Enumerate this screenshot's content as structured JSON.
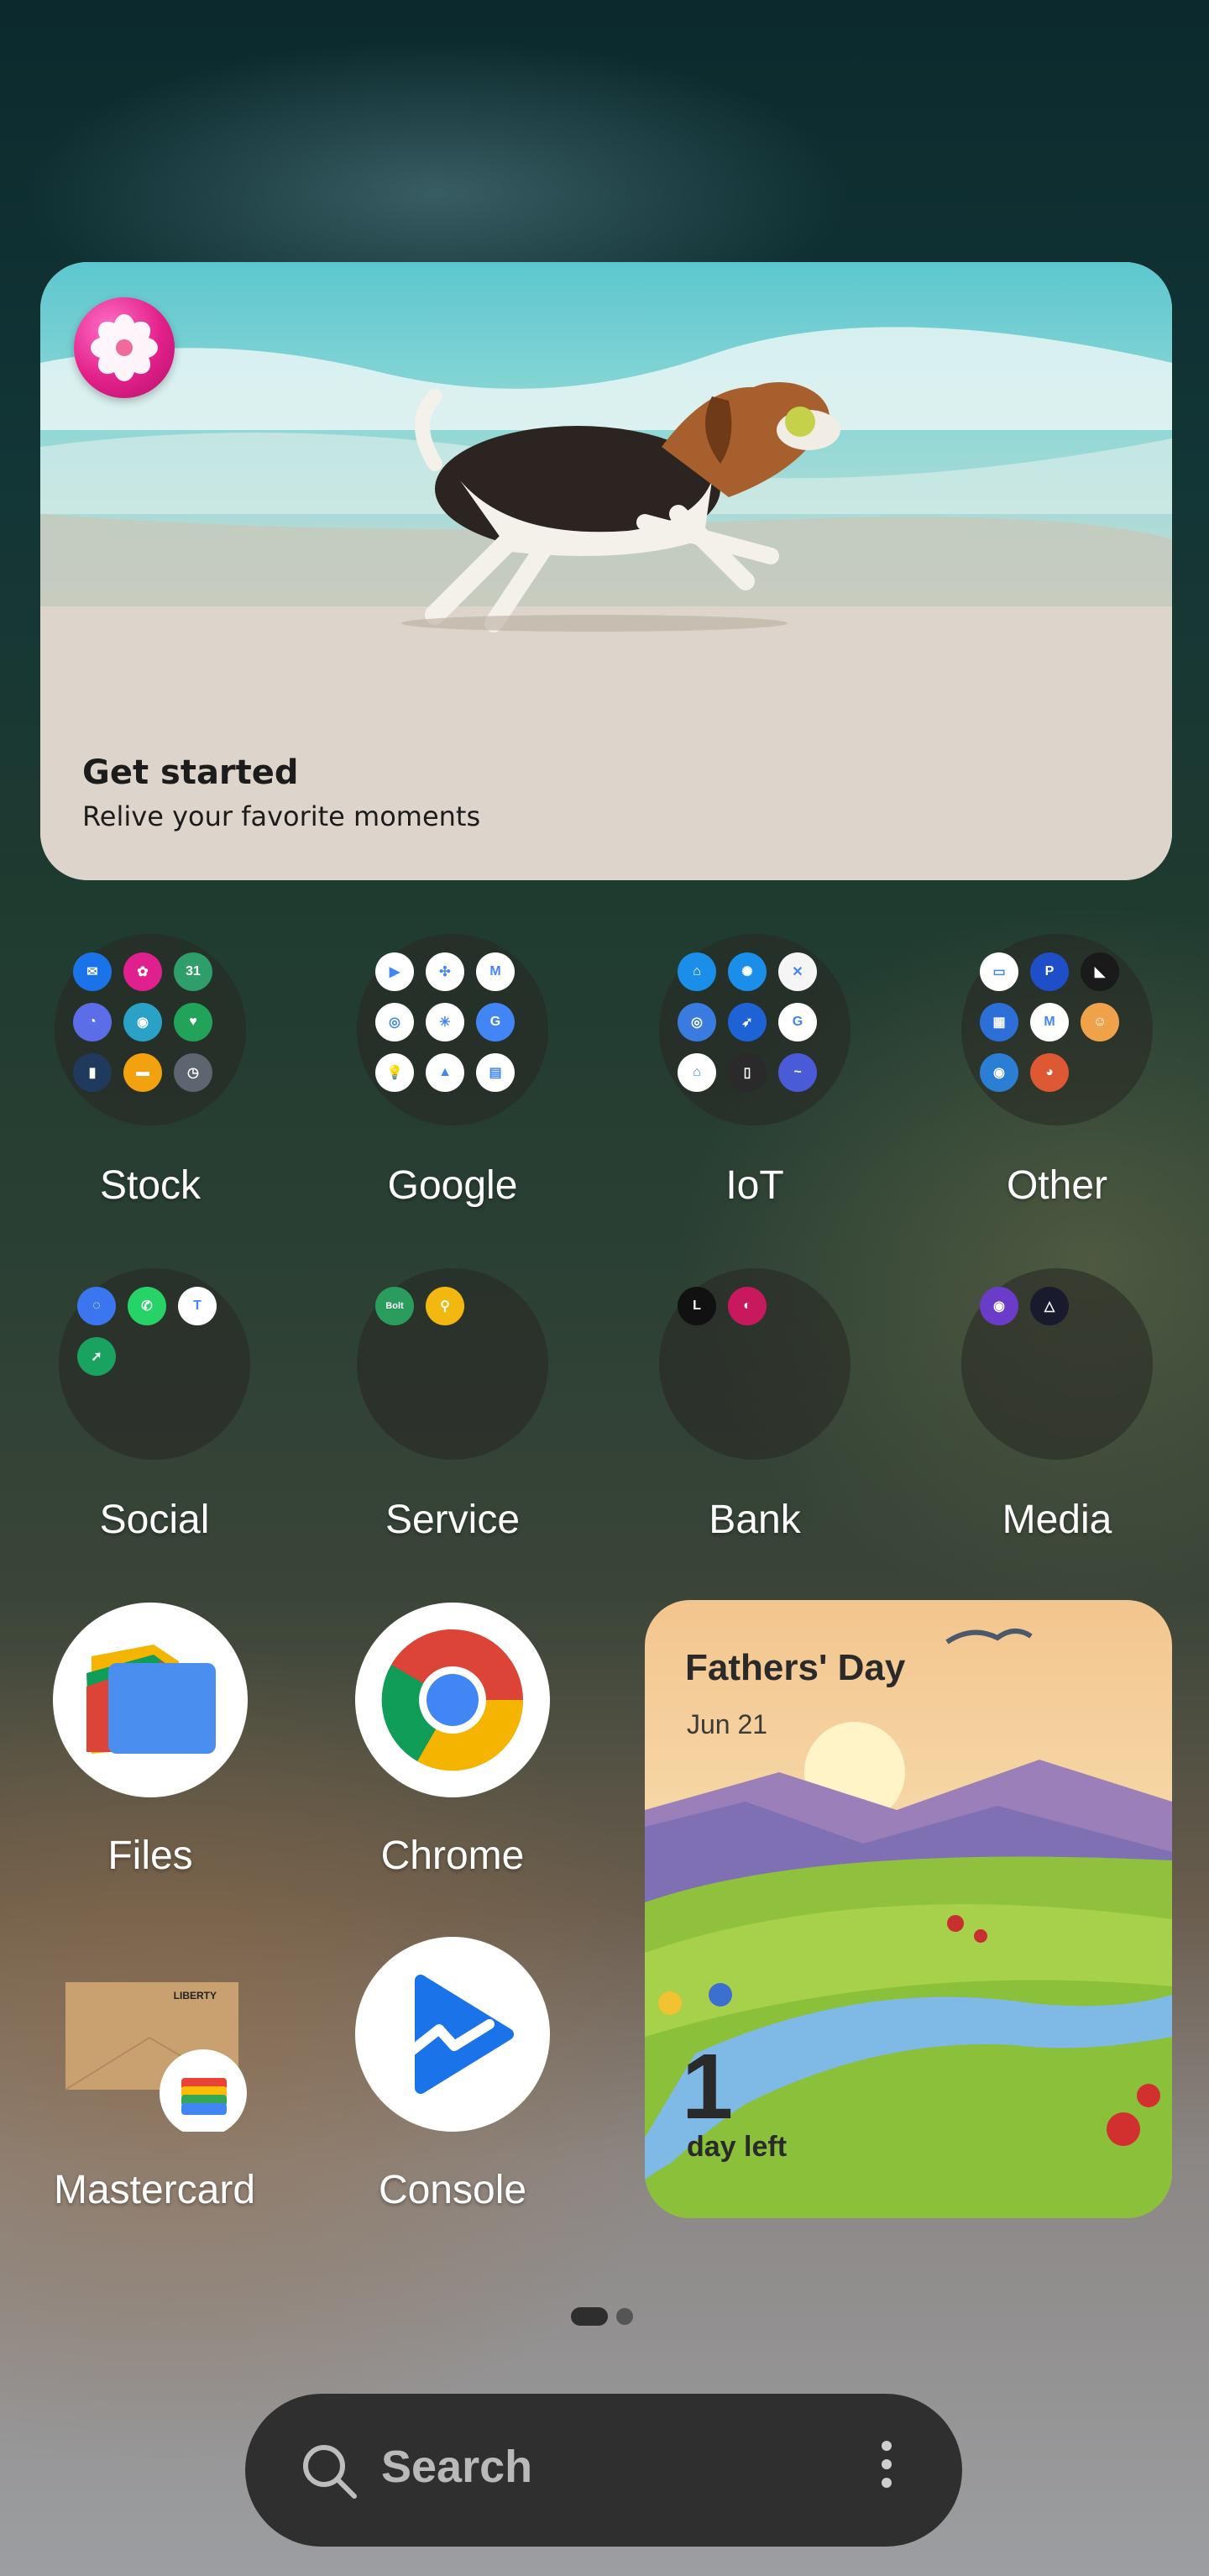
{
  "memory_widget": {
    "title": "Get started",
    "subtitle": "Relive your favorite moments",
    "badge_icon": "gallery-flower-icon"
  },
  "folders": [
    {
      "name": "Stock",
      "apps": [
        {
          "icon": "messages-icon",
          "color": "#1a73e8",
          "glyph": "✉"
        },
        {
          "icon": "gallery-icon",
          "color": "#e0208e",
          "glyph": "✿"
        },
        {
          "icon": "calendar-icon",
          "color": "#2e9e6a",
          "glyph": "31"
        },
        {
          "icon": "internet-icon",
          "color": "#5b6ee8",
          "glyph": "◔"
        },
        {
          "icon": "bixby-icon",
          "color": "#2aa2c8",
          "glyph": "◉"
        },
        {
          "icon": "health-icon",
          "color": "#21a35a",
          "glyph": "♥"
        },
        {
          "icon": "wallet-icon",
          "color": "#1f3a5c",
          "glyph": "▮"
        },
        {
          "icon": "my-files-icon",
          "color": "#f2a20f",
          "glyph": "▬"
        },
        {
          "icon": "clock-icon",
          "color": "#5d6670",
          "glyph": "◷"
        }
      ]
    },
    {
      "name": "Google",
      "apps": [
        {
          "icon": "play-store-icon",
          "color": "#ffffff",
          "glyph": "▶"
        },
        {
          "icon": "photos-icon",
          "color": "#ffffff",
          "glyph": "✣"
        },
        {
          "icon": "gmail-icon",
          "color": "#ffffff",
          "glyph": "M"
        },
        {
          "icon": "chrome-mini-icon",
          "color": "#ffffff",
          "glyph": "◎"
        },
        {
          "icon": "assistant-icon",
          "color": "#ffffff",
          "glyph": "✳"
        },
        {
          "icon": "translate-icon",
          "color": "#4285f4",
          "glyph": "G"
        },
        {
          "icon": "keep-icon",
          "color": "#ffffff",
          "glyph": "💡"
        },
        {
          "icon": "drive-icon",
          "color": "#ffffff",
          "glyph": "▲"
        },
        {
          "icon": "docs-icon",
          "color": "#ffffff",
          "glyph": "▤"
        }
      ]
    },
    {
      "name": "IoT",
      "apps": [
        {
          "icon": "smartthings-icon",
          "color": "#1a8ee8",
          "glyph": "⌂"
        },
        {
          "icon": "hub-icon",
          "color": "#1a8ee8",
          "glyph": "✺"
        },
        {
          "icon": "x-app-icon",
          "color": "#f5f5f5",
          "glyph": "✕"
        },
        {
          "icon": "circle-app-icon",
          "color": "#3a7be0",
          "glyph": "◎"
        },
        {
          "icon": "bird-app-icon",
          "color": "#1e63d6",
          "glyph": "➶"
        },
        {
          "icon": "g-app-icon",
          "color": "#ffffff",
          "glyph": "G"
        },
        {
          "icon": "home-app-icon",
          "color": "#ffffff",
          "glyph": "⌂"
        },
        {
          "icon": "remote-icon",
          "color": "#2a2a2a",
          "glyph": "▯"
        },
        {
          "icon": "velop-icon",
          "color": "#4a5bd8",
          "glyph": "~"
        }
      ]
    },
    {
      "name": "Other",
      "apps": [
        {
          "icon": "card-app-icon",
          "color": "#ffffff",
          "glyph": "▭"
        },
        {
          "icon": "playstation-icon",
          "color": "#1e4fc8",
          "glyph": "P"
        },
        {
          "icon": "flag-app-icon",
          "color": "#1a1a1a",
          "glyph": "◣"
        },
        {
          "icon": "grid-app-icon",
          "color": "#2c6fd8",
          "glyph": "▦"
        },
        {
          "icon": "proton-mail-icon",
          "color": "#ffffff",
          "glyph": "M"
        },
        {
          "icon": "face-app-icon",
          "color": "#f0a24a",
          "glyph": "☺"
        },
        {
          "icon": "profile-app-icon",
          "color": "#2a7fd4",
          "glyph": "◉"
        },
        {
          "icon": "duckduckgo-icon",
          "color": "#de5833",
          "glyph": "◕"
        }
      ]
    },
    {
      "name": "Social",
      "apps": [
        {
          "icon": "signal-icon",
          "color": "#3a76f0",
          "glyph": "◌"
        },
        {
          "icon": "whatsapp-icon",
          "color": "#25d366",
          "glyph": "✆"
        },
        {
          "icon": "teams-icon",
          "color": "#ffffff",
          "glyph": "T"
        },
        {
          "icon": "share-app-icon",
          "color": "#1aa260",
          "glyph": "➚"
        }
      ]
    },
    {
      "name": "Service",
      "apps": [
        {
          "icon": "bolt-icon",
          "color": "#2a9d5c",
          "glyph": "Bolt"
        },
        {
          "icon": "location-app-icon",
          "color": "#f2b80f",
          "glyph": "⚲"
        }
      ]
    },
    {
      "name": "Bank",
      "apps": [
        {
          "icon": "liberty-icon",
          "color": "#111111",
          "glyph": "L"
        },
        {
          "icon": "bank-app-icon",
          "color": "#c8185e",
          "glyph": "◐"
        }
      ]
    },
    {
      "name": "Media",
      "apps": [
        {
          "icon": "podcast-icon",
          "color": "#6a3cc8",
          "glyph": "◉"
        },
        {
          "icon": "proton-vpn-icon",
          "color": "#1a1a2e",
          "glyph": "△"
        }
      ]
    }
  ],
  "apps": {
    "files": "Files",
    "chrome": "Chrome",
    "mastercard": "Mastercard",
    "console": "Console"
  },
  "event_widget": {
    "title": "Fathers' Day",
    "date": "Jun 21",
    "count": "1",
    "count_label": "day left"
  },
  "pager": {
    "pages": 2,
    "active": 1
  },
  "search": {
    "placeholder": "Search"
  }
}
